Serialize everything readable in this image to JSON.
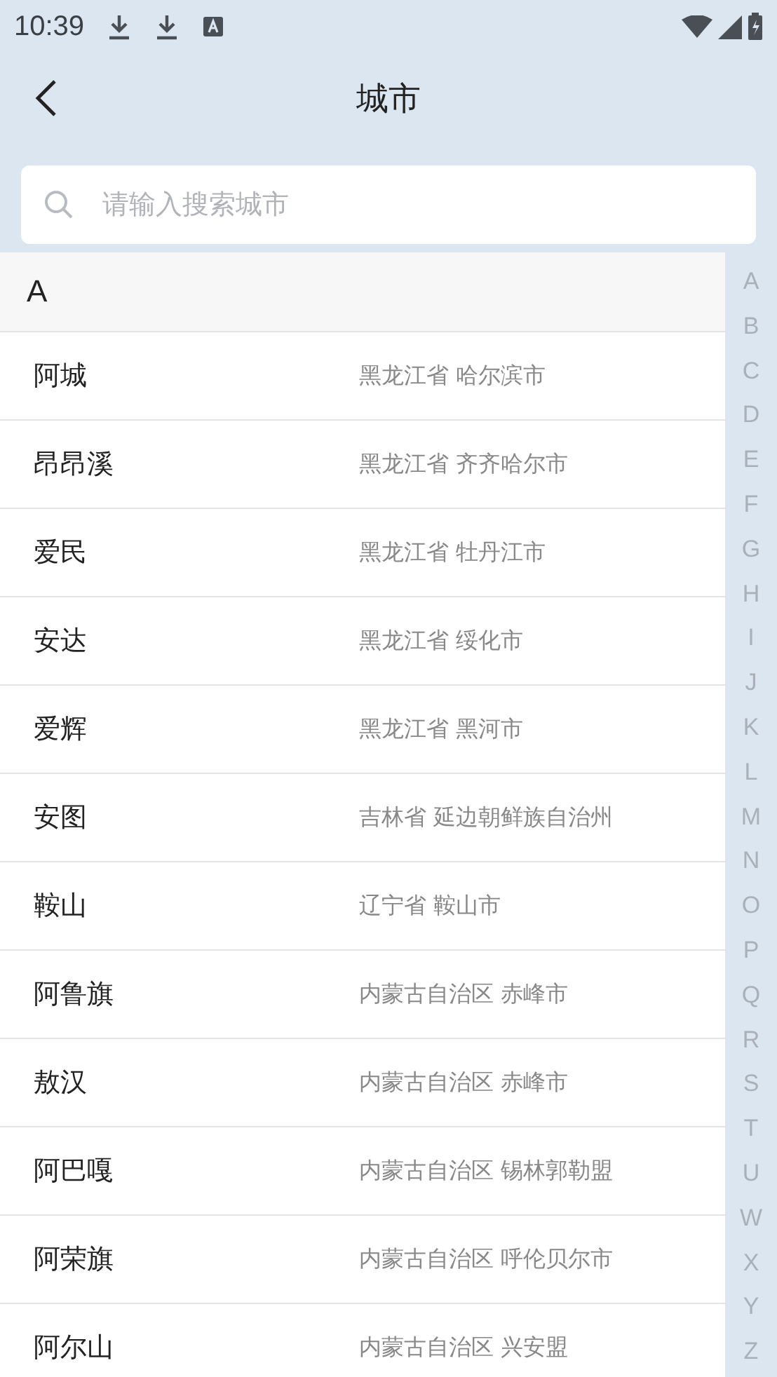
{
  "status_bar": {
    "time": "10:39"
  },
  "header": {
    "title": "城市"
  },
  "search": {
    "placeholder": "请输入搜索城市"
  },
  "section": {
    "letter": "A"
  },
  "cities": [
    {
      "name": "阿城",
      "region": "黑龙江省 哈尔滨市"
    },
    {
      "name": "昂昂溪",
      "region": "黑龙江省 齐齐哈尔市"
    },
    {
      "name": "爱民",
      "region": "黑龙江省 牡丹江市"
    },
    {
      "name": "安达",
      "region": "黑龙江省 绥化市"
    },
    {
      "name": "爱辉",
      "region": "黑龙江省 黑河市"
    },
    {
      "name": "安图",
      "region": "吉林省 延边朝鲜族自治州"
    },
    {
      "name": "鞍山",
      "region": "辽宁省 鞍山市"
    },
    {
      "name": "阿鲁旗",
      "region": "内蒙古自治区 赤峰市"
    },
    {
      "name": "敖汉",
      "region": "内蒙古自治区 赤峰市"
    },
    {
      "name": "阿巴嘎",
      "region": "内蒙古自治区 锡林郭勒盟"
    },
    {
      "name": "阿荣旗",
      "region": "内蒙古自治区 呼伦贝尔市"
    },
    {
      "name": "阿尔山",
      "region": "内蒙古自治区 兴安盟"
    }
  ],
  "index": [
    "A",
    "B",
    "C",
    "D",
    "E",
    "F",
    "G",
    "H",
    "I",
    "J",
    "K",
    "L",
    "M",
    "N",
    "O",
    "P",
    "Q",
    "R",
    "S",
    "T",
    "U",
    "W",
    "X",
    "Y",
    "Z"
  ]
}
